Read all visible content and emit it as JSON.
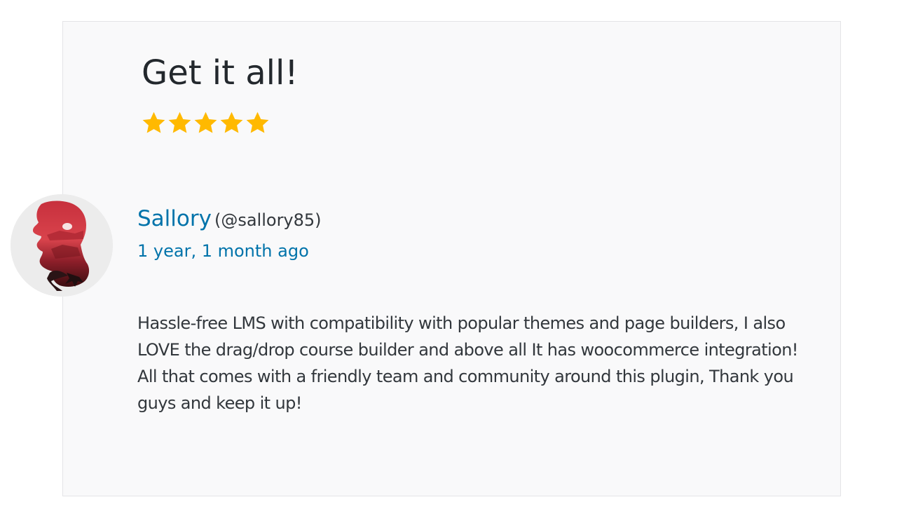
{
  "review": {
    "title": "Get it all!",
    "rating": 5,
    "rating_max": 5,
    "star_color": "#ffb900",
    "author": {
      "name": "Sallory",
      "handle": "(@sallory85)",
      "avatar_icon": "silhouette-avatar"
    },
    "date": "1 year, 1 month ago",
    "body": [
      "Hassle-free LMS with compatibility with popular themes and page builders, I also LOVE the drag/drop course builder and above all It has woocommerce integration!",
      "All that comes with a friendly team and community around this plugin, Thank you guys and keep it up!"
    ]
  },
  "colors": {
    "link": "#0073aa",
    "text": "#32373c",
    "card_background": "#f9f9fa"
  }
}
